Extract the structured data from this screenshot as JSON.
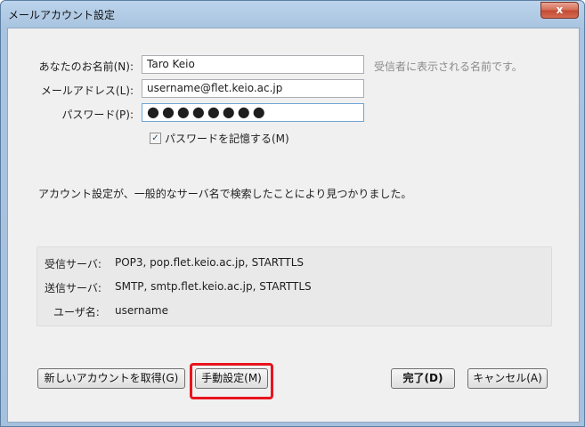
{
  "window": {
    "title": "メールアカウント設定",
    "close": "x"
  },
  "form": {
    "name_label": "あなたのお名前(N):",
    "name_value": "Taro Keio",
    "name_hint": "受信者に表示される名前です。",
    "email_label": "メールアドレス(L):",
    "email_value": "username@flet.keio.ac.jp",
    "password_label": "パスワード(P):",
    "password_value": "●●●●●●●●",
    "remember_label": "パスワードを記憶する(M)",
    "remember_checked": true
  },
  "status": {
    "message": "アカウント設定が、一般的なサーバ名で検索したことにより見つかりました。"
  },
  "summary": {
    "incoming_label": "受信サーバ:",
    "incoming_value": "POP3, pop.flet.keio.ac.jp, STARTTLS",
    "outgoing_label": "送信サーバ:",
    "outgoing_value": "SMTP, smtp.flet.keio.ac.jp, STARTTLS",
    "username_label": "ユーザ名:",
    "username_value": "username"
  },
  "buttons": {
    "new_account": "新しいアカウントを取得(G)",
    "manual": "手動設定(M)",
    "done": "完了(D)",
    "cancel": "キャンセル(A)"
  },
  "colors": {
    "highlight": "#e8141e",
    "titlebar": "#a9c4e0"
  }
}
